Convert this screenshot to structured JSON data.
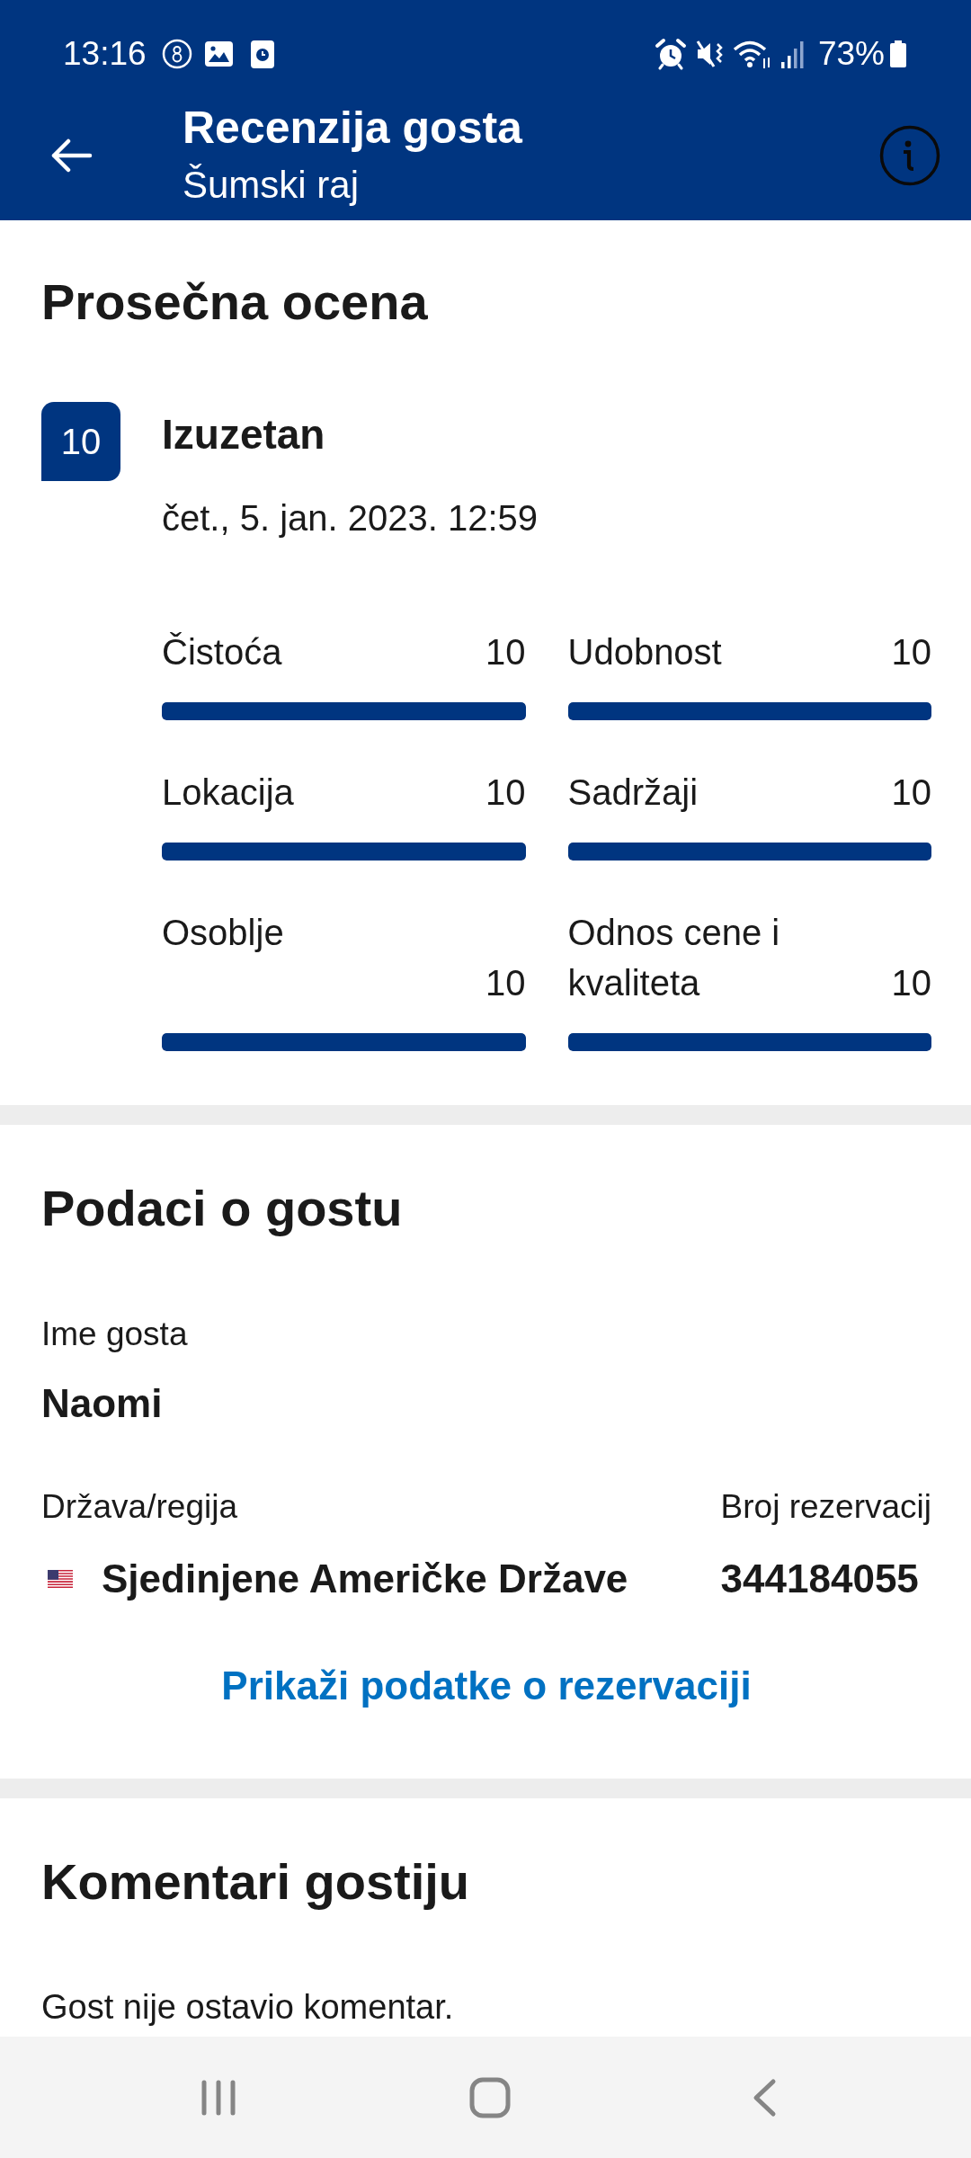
{
  "status_bar": {
    "time": "13:16",
    "battery": "73%"
  },
  "header": {
    "title": "Recenzija gosta",
    "subtitle": "Šumski raj"
  },
  "average_rating": {
    "title": "Prosečna ocena",
    "score": "10",
    "verdict": "Izuzetan",
    "date": "čet., 5. jan. 2023. 12:59",
    "categories": [
      {
        "label": "Čistoća",
        "score": "10",
        "level": 1
      },
      {
        "label": "Udobnost",
        "score": "10",
        "level": 1
      },
      {
        "label": "Lokacija",
        "score": "10",
        "level": 1
      },
      {
        "label": "Sadržaji",
        "score": "10",
        "level": 1
      },
      {
        "label": "Osoblje",
        "score": "10",
        "level": 1
      },
      {
        "label": "Odnos cene i kvaliteta",
        "score": "10",
        "level": 1
      }
    ]
  },
  "guest_info": {
    "title": "Podaci o gostu",
    "name_label": "Ime gosta",
    "name": "Naomi",
    "country_label": "Država/regija",
    "country": "Sjedinjene Američke Države",
    "booking_label": "Broj rezervacij",
    "booking_number": "344184055",
    "details_link": "Prikaži podatke o rezervaciji"
  },
  "comments": {
    "title": "Komentari gostiju",
    "text": "Gost nije ostavio komentar."
  }
}
